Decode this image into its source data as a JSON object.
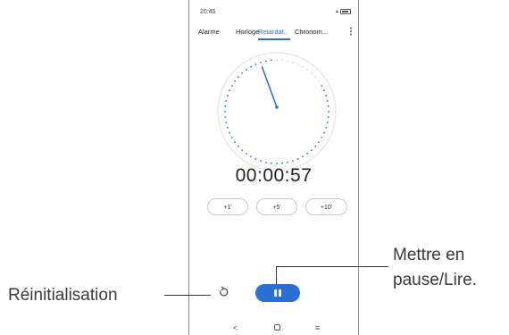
{
  "status_bar": {
    "time": "20:45"
  },
  "tabs": [
    "Alarme",
    "Horloge",
    "Retardat..",
    "Chronom..."
  ],
  "active_tab": 2,
  "overflow_icon": "more-vert-icon",
  "timer": {
    "display": "00:00:57",
    "progress_fraction": 0.16
  },
  "add_buttons": [
    "+1'",
    "+5'",
    "+10'"
  ],
  "controls": {
    "reset_icon": "reset-icon",
    "pause_icon": "pause-icon"
  },
  "nav": {
    "back": "<",
    "home_icon": "home-icon",
    "menu": "≡"
  },
  "callouts": {
    "reset": "Réinitialisation",
    "pause_line1": "Mettre en",
    "pause_line2": "pause/Lire."
  },
  "colors": {
    "accent": "#2b6fd6"
  }
}
